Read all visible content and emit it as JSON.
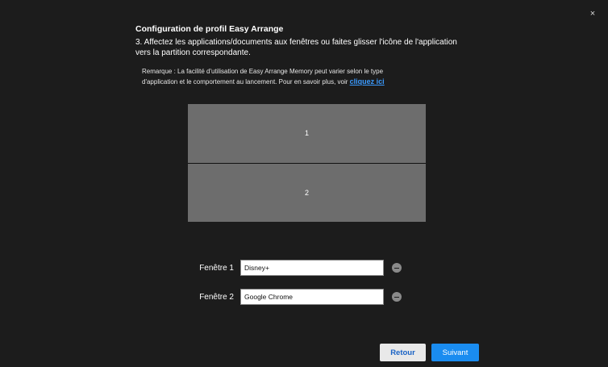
{
  "window": {
    "close_glyph": "×"
  },
  "header": {
    "title": "Configuration de profil Easy Arrange",
    "step_text": "3. Affectez les applications/documents aux fenêtres ou faites glisser l'icône de l'application vers la partition correspondante."
  },
  "note": {
    "text": "Remarque : La facilité d'utilisation de Easy Arrange Memory peut varier selon le type d'application et le comportement au lancement. Pour en savoir plus, voir ",
    "link_label": "cliquez ici"
  },
  "layout": {
    "partitions": [
      {
        "label": "1"
      },
      {
        "label": "2"
      }
    ]
  },
  "windows": [
    {
      "label": "Fenêtre 1",
      "value": "Disney+"
    },
    {
      "label": "Fenêtre 2",
      "value": "Google Chrome"
    }
  ],
  "footer": {
    "back_label": "Retour",
    "next_label": "Suivant"
  },
  "colors": {
    "background": "#1c1c1c",
    "accent": "#1a8cf0",
    "link": "#3b9bff",
    "partition": "#6d6d6d"
  },
  "icons": {
    "close": "close-icon",
    "remove": "remove-icon"
  }
}
